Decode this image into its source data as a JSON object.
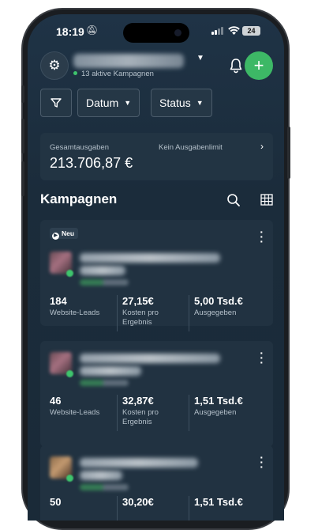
{
  "status_bar": {
    "time": "18:19",
    "battery": "24"
  },
  "header": {
    "account_subtitle": "13 aktive Kampagnen"
  },
  "filters": {
    "date_label": "Datum",
    "status_label": "Status"
  },
  "spend": {
    "label": "Gesamtausgaben",
    "limit_label": "Kein Ausgabenlimit",
    "amount": "213.706,87 €"
  },
  "section": {
    "title": "Kampagnen"
  },
  "campaigns": [
    {
      "badge": "Neu",
      "metrics": [
        {
          "value": "184",
          "label": "Website-Leads"
        },
        {
          "value": "27,15€",
          "label": "Kosten pro Ergebnis"
        },
        {
          "value": "5,00 Tsd.€",
          "label": "Ausgegeben"
        }
      ]
    },
    {
      "metrics": [
        {
          "value": "46",
          "label": "Website-Leads"
        },
        {
          "value": "32,87€",
          "label": "Kosten pro Ergebnis"
        },
        {
          "value": "1,51 Tsd.€",
          "label": "Ausgegeben"
        }
      ]
    },
    {
      "metrics": [
        {
          "value": "50",
          "label": ""
        },
        {
          "value": "30,20€",
          "label": ""
        },
        {
          "value": "1,51 Tsd.€",
          "label": ""
        }
      ]
    }
  ],
  "colors": {
    "accent_green": "#3db866",
    "background": "#1b2c3b",
    "card": "#213241"
  }
}
